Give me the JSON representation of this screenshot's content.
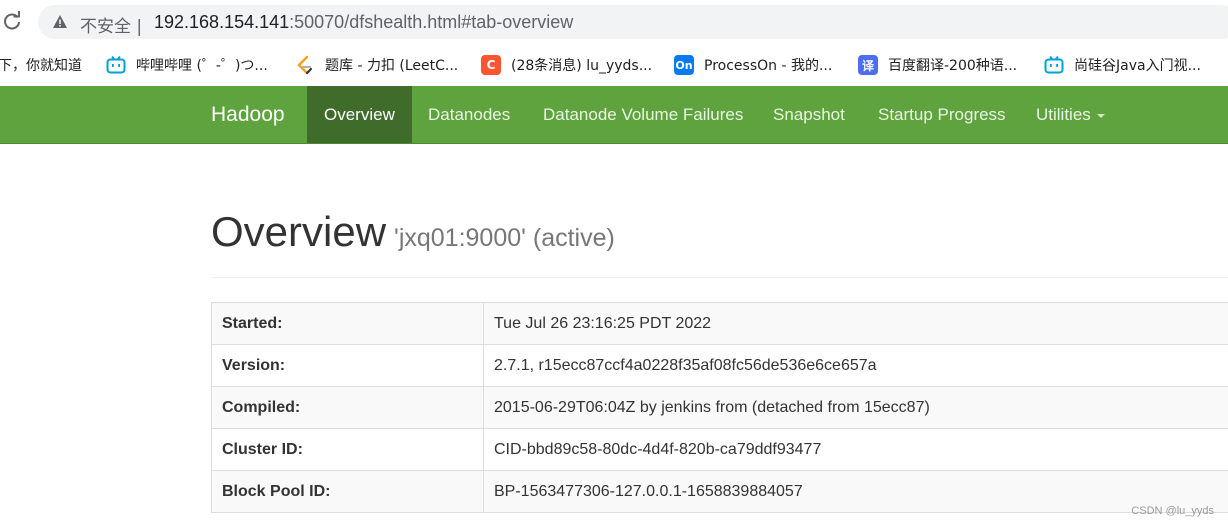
{
  "browser": {
    "insecure_label": "不安全",
    "separator": "|",
    "url_host": "192.168.154.141",
    "url_rest": ":50070/dfshealth.html#tab-overview"
  },
  "bookmarks": [
    {
      "label": "下，你就知道",
      "icon": "",
      "color": ""
    },
    {
      "label": "哔哩哔哩 (゜-゜)つ...",
      "icon": "bilibili-icon",
      "color": "#00a1d6"
    },
    {
      "label": "题库 - 力扣 (LeetC...",
      "icon": "leetcode-icon",
      "color": "#f89f1b"
    },
    {
      "label": "(28条消息) lu_yyds...",
      "icon": "csdn-icon",
      "color": "#fc5531"
    },
    {
      "label": "ProcessOn - 我的...",
      "icon": "processon-icon",
      "color": "#067bef"
    },
    {
      "label": "百度翻译-200种语...",
      "icon": "baidu-translate-icon",
      "color": "#4e6ef2"
    },
    {
      "label": "尚硅谷Java入门视...",
      "icon": "bilibili-icon",
      "color": "#00a1d6"
    }
  ],
  "bookmark_glyphs": {
    "processon": "On",
    "baidu": "译"
  },
  "navbar": {
    "brand": "Hadoop",
    "items": [
      "Overview",
      "Datanodes",
      "Datanode Volume Failures",
      "Snapshot",
      "Startup Progress",
      "Utilities"
    ],
    "active": "Overview",
    "color": "#5fa33e",
    "active_color": "#3f6c2a"
  },
  "header": {
    "title": "Overview",
    "subtitle": "'jxq01:9000' (active)"
  },
  "table": [
    {
      "key": "Started:",
      "value": "Tue Jul 26 23:16:25 PDT 2022"
    },
    {
      "key": "Version:",
      "value": "2.7.1, r15ecc87ccf4a0228f35af08fc56de536e6ce657a"
    },
    {
      "key": "Compiled:",
      "value": "2015-06-29T06:04Z by jenkins from (detached from 15ecc87)"
    },
    {
      "key": "Cluster ID:",
      "value": "CID-bbd89c58-80dc-4d4f-820b-ca79ddf93477"
    },
    {
      "key": "Block Pool ID:",
      "value": "BP-1563477306-127.0.0.1-1658839884057"
    }
  ],
  "watermark": "CSDN @lu_yyds"
}
